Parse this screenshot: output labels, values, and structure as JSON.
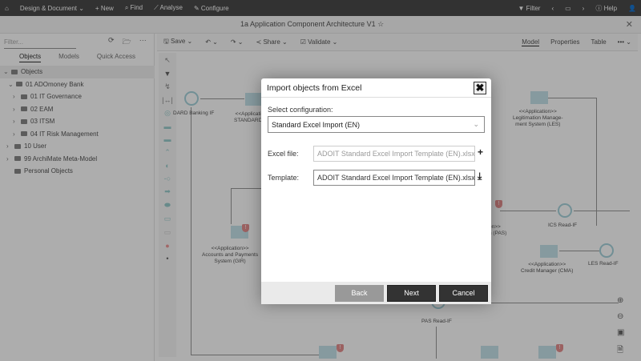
{
  "topbar": {
    "home": "home-icon",
    "menu": [
      "Design & Document ⌄",
      "+ New",
      "Find",
      "Analyse",
      "Configure"
    ],
    "filter": "Filter",
    "help": "Help"
  },
  "titlebar": {
    "title": "1a Application Component Architecture V1 ☆"
  },
  "sidebar": {
    "filter_placeholder": "Filter...",
    "tabs": [
      "Objects",
      "Models",
      "Quick Access"
    ],
    "tree": [
      "Objects",
      "01 ADOmoney Bank",
      "01 IT Governance",
      "02 EAM",
      "03 ITSM",
      "04 IT Risk Management",
      "10 User",
      "99 ArchiMate Meta-Model",
      "Personal Objects"
    ]
  },
  "canvas_toolbar": {
    "save": "Save ⌄",
    "share": "Share ⌄",
    "validate": "Validate ⌄",
    "views": [
      "Model",
      "Properties",
      "Table",
      "••• ⌄"
    ]
  },
  "diagram": {
    "labels": {
      "standard_banking_if": "DARD Banking IF",
      "standard_app": "<<Applicati\nSTANDARD",
      "les": "<<Application>>\nLegitimation Manage-\nment System (LES)",
      "gir": "<<Application>>\nAccounts and Payments\nSystem (GIR)",
      "pas": "on>>\nn (PAS)",
      "ics_read": "ICS Read-IF",
      "cma": "<<Application>>\nCredit Manager (CMA)",
      "les_read": "LES Read-IF",
      "pas_read": "PAS Read-IF"
    }
  },
  "dialog": {
    "title": "Import objects from Excel",
    "config_label": "Select configuration:",
    "config_value": "Standard Excel Import (EN)",
    "excel_label": "Excel file:",
    "excel_value": "ADOIT Standard Excel Import Template (EN).xlsx",
    "template_label": "Template:",
    "template_value": "ADOIT Standard Excel Import Template (EN).xlsx",
    "back": "Back",
    "next": "Next",
    "cancel": "Cancel"
  }
}
